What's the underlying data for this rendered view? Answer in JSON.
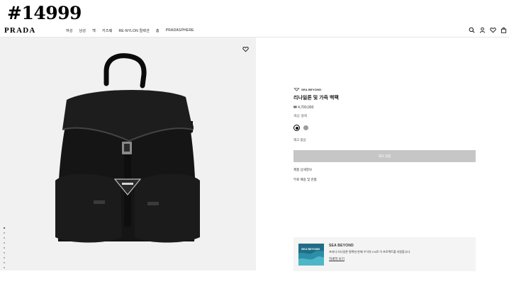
{
  "overlay_id": "#14999",
  "brand": "PRADA",
  "nav": [
    "여성",
    "남성",
    "백",
    "키즈웨",
    "RE-NYLON 컬렉션",
    "홈",
    "PRADASPHERE"
  ],
  "header_icons": [
    "search-icon",
    "account-icon",
    "wishlist-icon",
    "bag-icon"
  ],
  "gallery": {
    "slide_count": 10,
    "active_index": 0
  },
  "product": {
    "collection": "SEA BEYOND",
    "title": "리나일론 및 가죽 백팩",
    "price": "₩ 4,700,000",
    "color_label": "색상: 블랙",
    "colors": [
      {
        "name": "black",
        "hex": "#111111",
        "selected": true
      },
      {
        "name": "grey",
        "hex": "#9c9c9c",
        "selected": false
      }
    ],
    "stock_status": "재고 없음",
    "cta_label": "재고 알림",
    "details_link": "제품 상세정보",
    "shipping_link": "무료 배송 및 반품"
  },
  "promo": {
    "title": "SEA BEYOND",
    "text": "프라다 리나일론 컬렉션 판매 수익의 1%로 이 프로젝트를 지원합니다.",
    "link": "자세히 보기"
  },
  "colors": {
    "button_disabled": "#c6c6c6",
    "image_bg": "#f1f1f1",
    "promo_bg": "#f4f4f4"
  }
}
